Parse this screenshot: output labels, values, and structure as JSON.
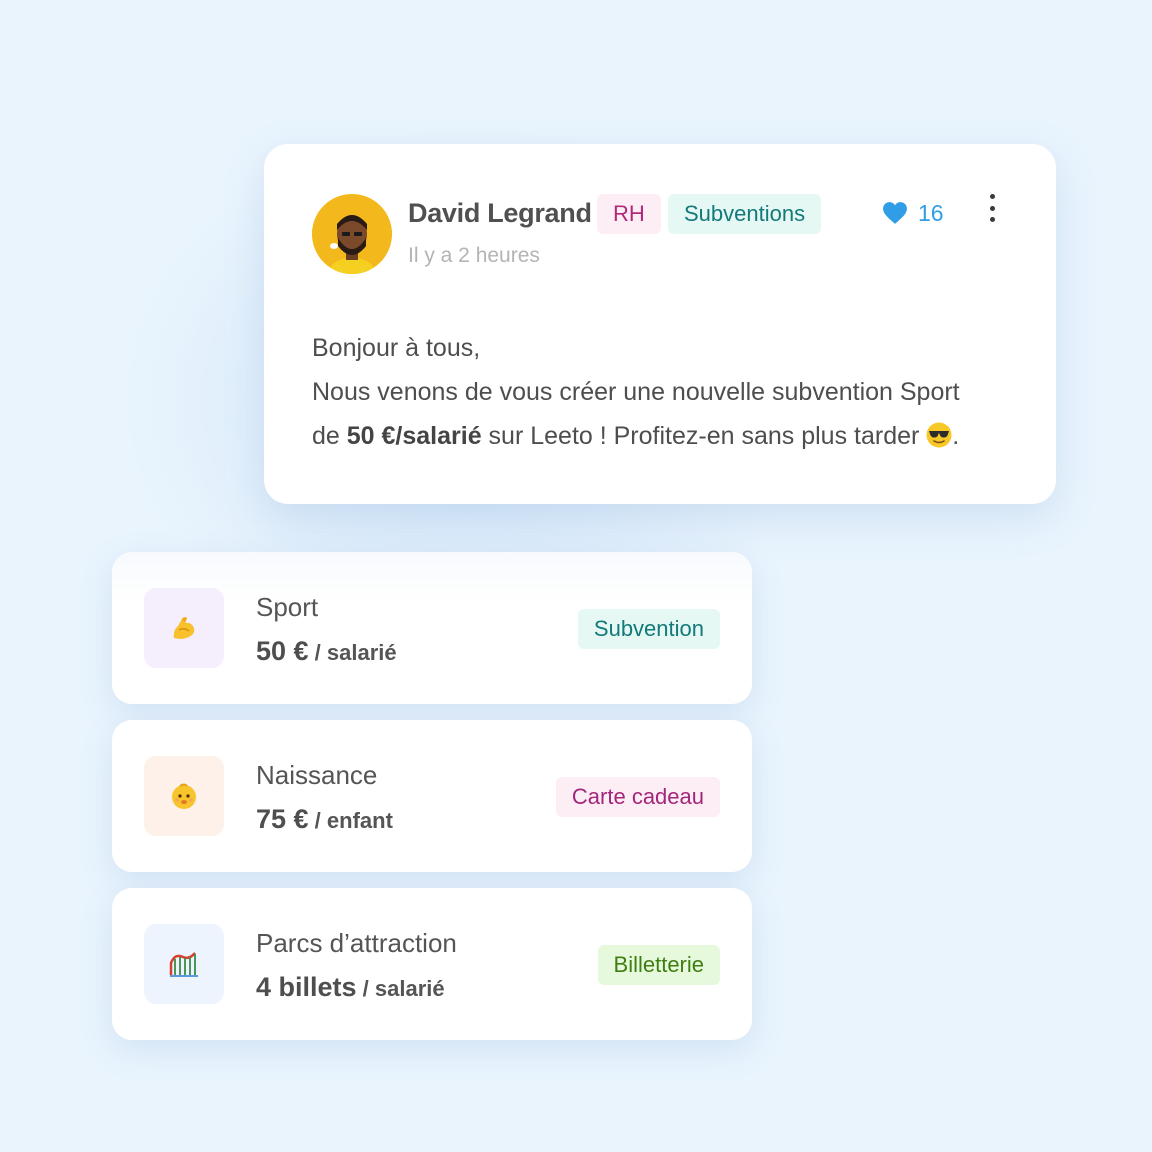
{
  "colors": {
    "background": "#e9f4fd",
    "tag_rh_bg": "#fdeef5",
    "tag_rh_text": "#b1287a",
    "tag_subventions_bg": "#e6f8f4",
    "tag_subventions_text": "#127a7a",
    "like_blue": "#2f9ee6",
    "billetterie_bg": "#e7f9dd",
    "billetterie_text": "#3f7f12"
  },
  "post": {
    "author": "David Legrand",
    "tags": [
      "RH",
      "Subventions"
    ],
    "time": "Il y a 2 heures",
    "likes": "16",
    "body_line1": "Bonjour à tous,",
    "body_line2": "Nous venons de vous créer une nouvelle subvention Sport",
    "body_line3_prefix": "de ",
    "body_line3_bold": "50 €/salarié",
    "body_line3_suffix": " sur Leeto ! Profitez-en sans plus tarder ",
    "body_line3_end": ".",
    "avatar_icon": "man-avatar-icon",
    "emoji_icon": "sunglasses-emoji-icon"
  },
  "items": [
    {
      "title": "Sport",
      "amount": "50 €",
      "unit": " / salarié",
      "tag": "Subvention",
      "icon": "flexed-biceps-emoji-icon",
      "icon_bg": "#f5eefd",
      "tag_bg": "#e6f8f4",
      "tag_text": "#127a7a"
    },
    {
      "title": "Naissance",
      "amount": "75 €",
      "unit": " / enfant",
      "tag": "Carte cadeau",
      "icon": "baby-emoji-icon",
      "icon_bg": "#fdf1ea",
      "tag_bg": "#fdeef5",
      "tag_text": "#a3267a"
    },
    {
      "title": "Parcs d’attraction",
      "amount": "4 billets",
      "unit": " / salarié",
      "tag": "Billetterie",
      "icon": "roller-coaster-emoji-icon",
      "icon_bg": "#eef4fd",
      "tag_bg": "#e7f9dd",
      "tag_text": "#3f7f12"
    }
  ]
}
